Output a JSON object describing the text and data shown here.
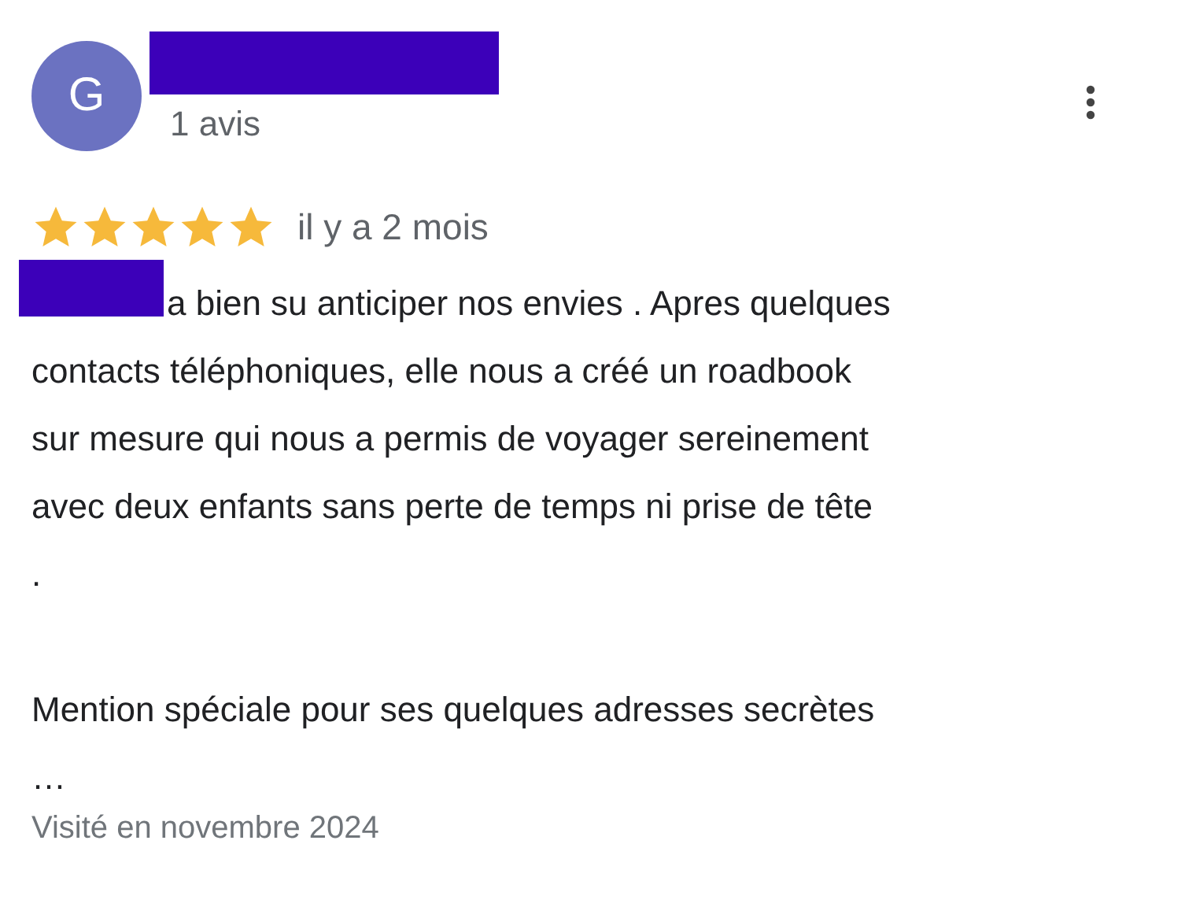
{
  "review": {
    "avatar_letter": "G",
    "author_redacted": true,
    "review_count": "1 avis",
    "stars": 5,
    "time": "il y a 2 mois",
    "body_redacted": true,
    "paragraphs": [
      "a bien su anticiper nos envies . Apres quelques\ncontacts téléphoniques, elle nous a créé un roadbook\nsur mesure qui nous a permis de voyager sereinement\navec deux enfants sans perte de temps ni prise de tête\n.",
      "Mention spéciale pour ses quelques adresses secrètes\n…"
    ],
    "visited": "Visité en novembre 2024"
  }
}
